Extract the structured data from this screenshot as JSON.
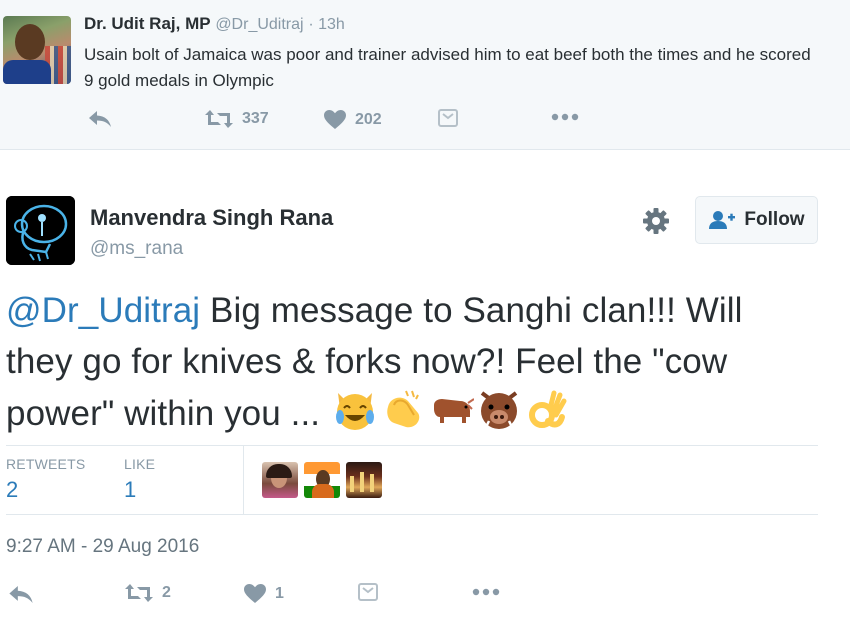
{
  "parent_tweet": {
    "name": "Dr. Udit Raj, MP",
    "handle": "@Dr_Uditraj",
    "time": "· 13h",
    "text": "Usain bolt of Jamaica was poor and trainer advised him  to eat beef both the times and he scored 9 gold medals in Olympic",
    "retweets": "337",
    "likes": "202",
    "icons": [
      "reply-icon",
      "retweet-icon",
      "heart-icon",
      "moment-icon",
      "more-icon"
    ]
  },
  "tweet": {
    "name": "Manvendra Singh Rana",
    "handle": "@ms_rana",
    "follow_label": "Follow",
    "mention": "@Dr_Uditraj",
    "text_line1": " Big message to Sanghi clan!!! Will",
    "text_line2": "they go for knives & forks now?! Feel the \"cow",
    "text_line3": "power\" within you ... ",
    "emojis": [
      "tears-of-joy-cat-emoji",
      "clapping-hands-emoji",
      "ox-emoji",
      "boar-emoji",
      "ok-hand-emoji"
    ],
    "stats": {
      "retweets_label": "RETWEETS",
      "retweets_value": "2",
      "likes_label": "LIKE",
      "likes_value": "1"
    },
    "timestamp": "9:27 AM - 29 Aug 2016",
    "actions": {
      "retweet_count": "2",
      "like_count": "1"
    }
  },
  "colors": {
    "link": "#2b7bb9",
    "muted": "#8899a6",
    "text": "#292f33",
    "border": "#e1e8ed"
  }
}
